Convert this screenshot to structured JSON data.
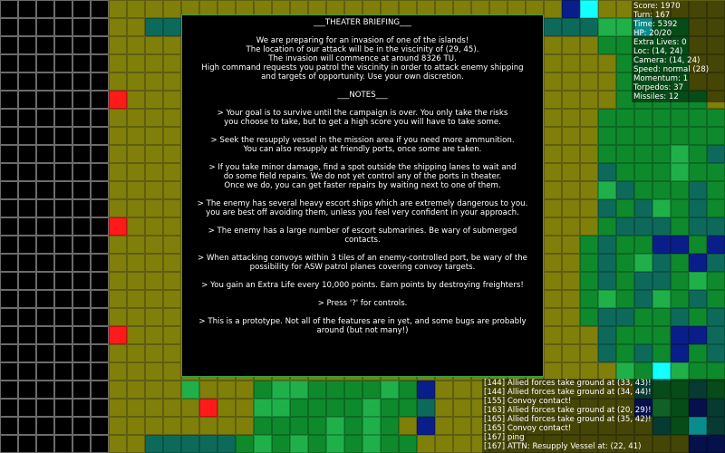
{
  "colors": {
    "ocean_black": "#000000",
    "olive_shallows": "#7f7f0a",
    "green_sea": "#0e8a2c",
    "light_green": "#20b04a",
    "teal": "#0d6a5a",
    "navy": "#0a1e8a",
    "cyan_marker": "#14ffff",
    "red_marker": "#ff1a1a"
  },
  "map": {
    "rows": [
      "bbbbbboooooooooooooooooooooooooncooooooo",
      "bbbbbbootttttttttttttttttttttttttGGcggoo",
      "bbbbbbooooooooooooooooooooooooooogggggoo",
      "bbbbbbooooooooooooooooooooooooooooggggoo",
      "bbbbbbooooooooooooooooooooooooooooggggoo",
      "bbbbbbrooooooooooooooooooooooooooogggggo",
      "bbbbbboooooooooooooooooooooooooooggggggg",
      "bbbbbboooooooooooooooooooooooooooggggggg",
      "bbbbbboooooooooooooooooooooooooooggggGgt",
      "bbbbbboooooooooooooooooooooooooootgggGgg",
      "bbbbbboooooooooooooooooooooooooooGtgggtg",
      "bbbbbboooooooooooooooooooooooooootgtGgtg",
      "bbbbbbroooooooooooooooooooooooooogtttgtt",
      "bbbbbboooooooooooooooooooooooooogtggnngn",
      "bbbbbboooooooooooooooooooooooooogtgGtgnt",
      "bbbbbboooooooooooooooooooooooooogtgttgGg",
      "bbbbbboooooooooooooooooooooooooogGgtGgtg",
      "bbbbbboooooooooooooooooooooooooogttggtgt",
      "bbbbbbrooooooooooooooooooooooooootgggnnt",
      "bbbbbboooooooooooooooooooooooooootgtgngt",
      "bbbbbbooooooooooooooooooooooooooooGgcGgg",
      "bbbbbbooooGooogGGggggGgnoooooooooootggtg",
      "bbbbbbooooorooGGggggGggtooooooooooonGgnt",
      "bbbbbbooooooooggggGgGgonooooooooooootgct",
      "bbbbbbootttttgGgGgGgGggooooooooooooooonn"
    ]
  },
  "briefing": {
    "title": "___THEATER BRIEFING___",
    "intro": [
      "We are preparing for an invasion of one of the islands!",
      "The location of our attack will be in the viscinity of (29, 45).",
      "The invasion will commence at around 8326 TU.",
      "High command requests you patrol the viscinity in order to attack enemy shipping",
      "and targets of opportunity. Use your own discretion."
    ],
    "notes_title": "___NOTES___",
    "notes": [
      [
        "> Your goal is to survive until the campaign is over. You only take the risks",
        "you choose to take, but to get a high score you will have to take some."
      ],
      [
        "> Seek the resupply vessel in the mission area if you need more ammunition.",
        "You can also resupply at friendly ports, once some are taken."
      ],
      [
        "> If you take minor damage, find a spot outside the shipping lanes to wait and",
        "do some field repairs. We do not yet control any of the ports in theater.",
        "Once we do, you can get faster repairs by waiting next to one of them."
      ],
      [
        "> The enemy has several heavy escort ships which are extremely dangerous to you.",
        "you are best off avoiding them, unless you feel very confident in your approach."
      ],
      [
        "> The enemy has a large number of escort submarines. Be wary of submerged contacts."
      ],
      [
        "> When attacking convoys within 3 tiles of an enemy-controlled port, be wary of the",
        "possibility for ASW patrol planes covering convoy targets."
      ],
      [
        "> You gain an Extra Life every 10,000 points. Earn points by destroying freighters!"
      ],
      [
        "> Press '?' for controls."
      ],
      [
        "> This is a prototype. Not all of the features are in yet, and some bugs are probably",
        "around (but not many!)"
      ]
    ]
  },
  "stats": [
    "Score: 1970",
    "Turn: 167",
    "Time: 5392",
    "HP: 20/20",
    "Extra Lives: 0",
    "Loc: (14, 24)",
    "Camera: (14, 24)",
    "Speed: normal (28)",
    "Momentum: 1",
    "Torpedos: 37",
    "Missiles: 12"
  ],
  "log": [
    "[144] Allied forces take ground at (33, 43)!",
    "[144] Allied forces take ground at (34, 44)!",
    "[155] Convoy contact!",
    "[163] Allied forces take ground at (20, 29)!",
    "[165] Allied forces take ground at (35, 42)!",
    "[165] Convoy contact!",
    "[167] ping",
    "[167] ATTN: Resupply Vessel at: (22, 41)"
  ]
}
